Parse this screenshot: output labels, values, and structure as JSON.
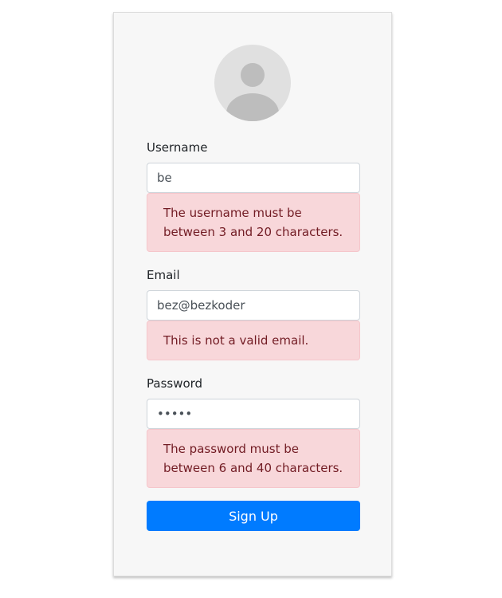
{
  "form": {
    "username": {
      "label": "Username",
      "value": "be",
      "error": "The username must be between 3 and 20 characters."
    },
    "email": {
      "label": "Email",
      "value": "bez@bezkoder",
      "error": "This is not a valid email."
    },
    "password": {
      "label": "Password",
      "value": "•••••",
      "error": "The password must be between 6 and 40 characters."
    },
    "submit_label": "Sign Up"
  },
  "colors": {
    "card_bg": "#f7f7f7",
    "alert_bg": "#f8d7da",
    "alert_text": "#721c24",
    "button": "#007bff"
  },
  "icons": {
    "avatar": "user-avatar-icon"
  }
}
